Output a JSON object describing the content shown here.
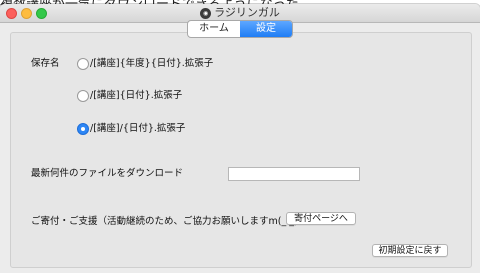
{
  "background_text": "複数講座が一気にダウンロードできるようになった",
  "window": {
    "title": "ラジリンガル",
    "app_icon": "app-icon",
    "controls": [
      "close",
      "minimize",
      "maximize"
    ]
  },
  "tabs": [
    {
      "label": "ホーム",
      "active": false
    },
    {
      "label": "設定",
      "active": true
    }
  ],
  "settings": {
    "save_name_label": "保存名",
    "save_name_options": [
      {
        "label": "/[講座]{年度}{日付}.拡張子",
        "selected": false
      },
      {
        "label": "/[講座]{日付}.拡張子",
        "selected": false
      },
      {
        "label": "/[講座]/{日付}.拡張子",
        "selected": true
      }
    ],
    "latest_download_label": "最新何件のファイルをダウンロード",
    "latest_download_value": "",
    "donation_label": "ご寄付・ご支援（活動継続のため、ご協力お願いしますm(_ _)m）",
    "donation_button": "寄付ページへ",
    "reset_button": "初期設定に戻す"
  },
  "colors": {
    "accent": "#2d86f5",
    "window_bg": "#ececec",
    "panel_bg": "#e6e6e6"
  }
}
